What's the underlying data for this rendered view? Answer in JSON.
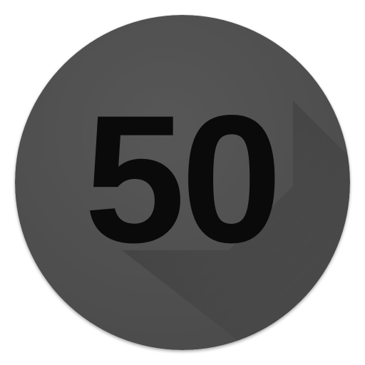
{
  "badge": {
    "number": "50",
    "colors": {
      "circle": "#4d4d4d",
      "circle_highlight": "#575757",
      "long_shadow": "#3f3f3f",
      "text": "#0a0a0a"
    }
  }
}
